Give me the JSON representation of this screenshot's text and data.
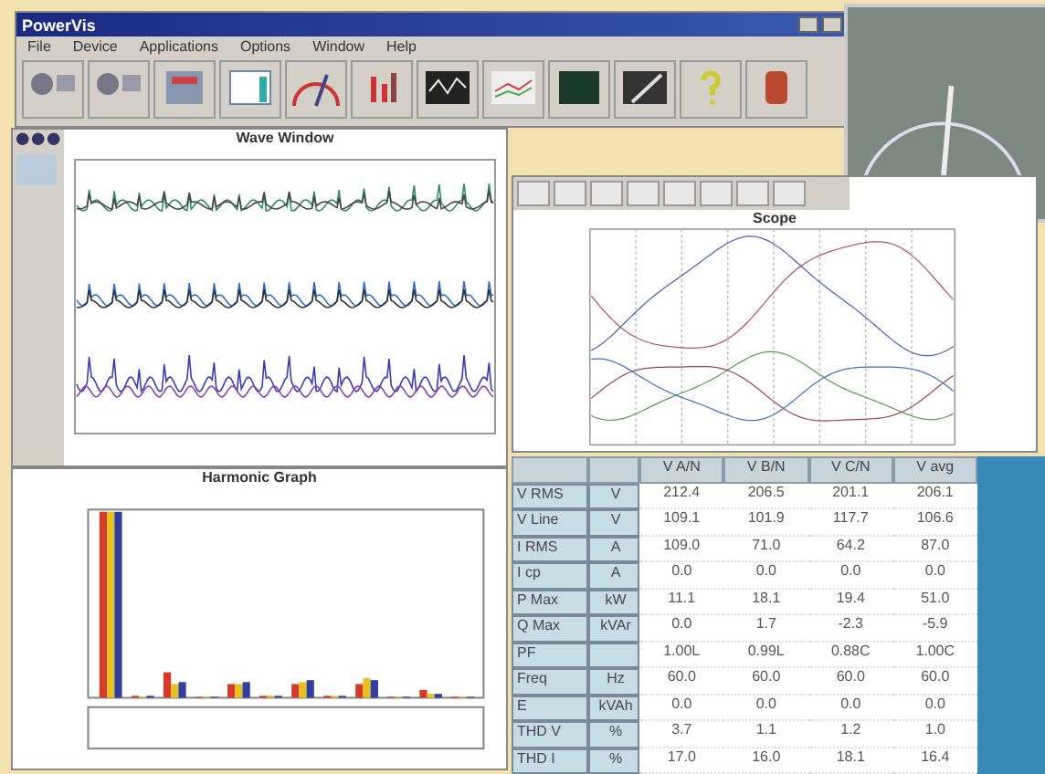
{
  "window": {
    "title": "PowerVis"
  },
  "menu": [
    "File",
    "Device",
    "Applications",
    "Options",
    "Window",
    "Help"
  ],
  "wave_window": {
    "title": "Wave Window"
  },
  "scope_window": {
    "title": "Scope"
  },
  "harmonic_window": {
    "title": "Harmonic Graph"
  },
  "table": {
    "columns": [
      "V A/N",
      "V B/N",
      "V C/N",
      "V avg"
    ],
    "rows": [
      {
        "name": "V RMS",
        "unit": "V",
        "values": [
          "212.4",
          "206.5",
          "201.1",
          "206.1"
        ]
      },
      {
        "name": "V Line",
        "unit": "V",
        "values": [
          "109.1",
          "101.9",
          "117.7",
          "106.6"
        ]
      },
      {
        "name": "I RMS",
        "unit": "A",
        "values": [
          "109.0",
          "71.0",
          "64.2",
          "87.0"
        ]
      },
      {
        "name": "I cp",
        "unit": "A",
        "values": [
          "0.0",
          "0.0",
          "0.0",
          "0.0"
        ]
      },
      {
        "name": "P Max",
        "unit": "kW",
        "values": [
          "11.1",
          "18.1",
          "19.4",
          "51.0"
        ]
      },
      {
        "name": "Q Max",
        "unit": "kVAr",
        "values": [
          "0.0",
          "1.7",
          "-2.3",
          "-5.9"
        ]
      },
      {
        "name": "PF",
        "unit": "",
        "values": [
          "1.00L",
          "0.99L",
          "0.88C",
          "1.00C"
        ]
      },
      {
        "name": "Freq",
        "unit": "Hz",
        "values": [
          "60.0",
          "60.0",
          "60.0",
          "60.0"
        ]
      },
      {
        "name": "E",
        "unit": "kVAh",
        "values": [
          "0.0",
          "0.0",
          "0.0",
          "0.0"
        ]
      },
      {
        "name": "THD V",
        "unit": "%",
        "values": [
          "3.7",
          "1.1",
          "1.2",
          "1.0"
        ]
      },
      {
        "name": "THD I",
        "unit": "%",
        "values": [
          "17.0",
          "16.0",
          "18.1",
          "16.4"
        ]
      }
    ]
  }
}
